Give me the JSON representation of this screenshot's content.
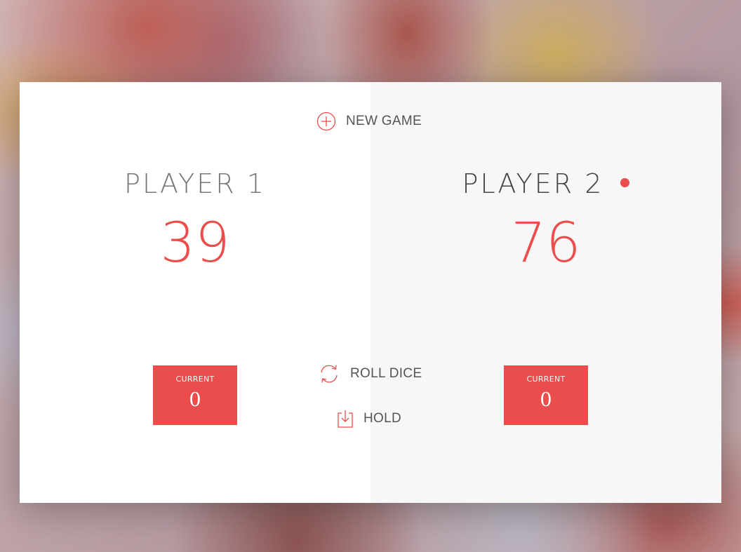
{
  "colors": {
    "accent": "#eb4d4d",
    "text": "#555555",
    "panel_left_bg": "#ffffff",
    "panel_right_bg": "#f7f7f7"
  },
  "controls": {
    "new_game": {
      "label": "NEW GAME",
      "icon": "plus-circle-icon"
    },
    "roll_dice": {
      "label": "ROLL DICE",
      "icon": "refresh-icon"
    },
    "hold": {
      "label": "HOLD",
      "icon": "download-icon"
    }
  },
  "players": [
    {
      "name": "PLAYER 1",
      "score": "39",
      "current_label": "CURRENT",
      "current_score": "0",
      "active": false
    },
    {
      "name": "PLAYER 2",
      "score": "76",
      "current_label": "CURRENT",
      "current_score": "0",
      "active": true
    }
  ]
}
